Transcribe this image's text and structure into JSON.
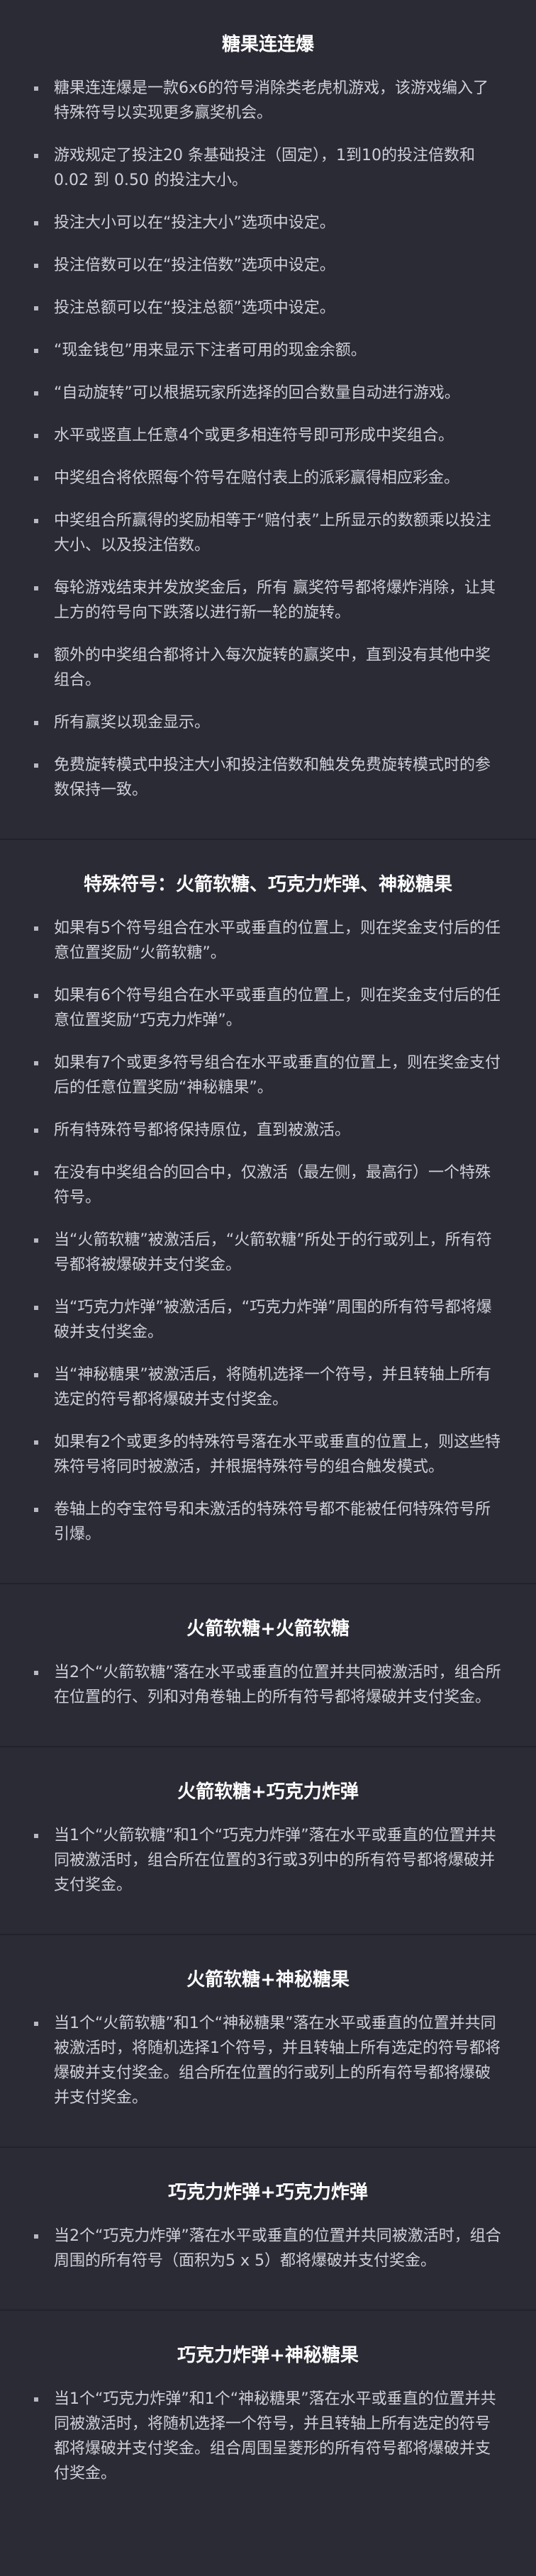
{
  "sections": [
    {
      "title": "糖果连连爆",
      "items": [
        "糖果连连爆是一款6x6的符号消除类老虎机游戏，该游戏编入了特殊符号以实现更多赢奖机会。",
        "游戏规定了投注20 条基础投注（固定），1到10的投注倍数和 0.02 到 0.50 的投注大小。",
        "投注大小可以在“投注大小”选项中设定。",
        "投注倍数可以在“投注倍数”选项中设定。",
        "投注总额可以在“投注总额”选项中设定。",
        "“现金钱包”用来显示下注者可用的现金余额。",
        "“自动旋转”可以根据玩家所选择的回合数量自动进行游戏。",
        "水平或竖直上任意4个或更多相连符号即可形成中奖组合。",
        "中奖组合将依照每个符号在赔付表上的派彩赢得相应彩金。",
        "中奖组合所赢得的奖励相等于“赔付表”上所显示的数额乘以投注大小、以及投注倍数。",
        "每轮游戏结束并发放奖金后，所有 赢奖符号都将爆炸消除，让其上方的符号向下跌落以进行新一轮的旋转。",
        "额外的中奖组合都将计入每次旋转的赢奖中，直到没有其他中奖组合。",
        "所有赢奖以现金显示。",
        "免费旋转模式中投注大小和投注倍数和触发免费旋转模式时的参数保持一致。"
      ]
    },
    {
      "title": "特殊符号：火箭软糖、巧克力炸弹、神秘糖果",
      "items": [
        "如果有5个符号组合在水平或垂直的位置上，则在奖金支付后的任意位置奖励“火箭软糖”。",
        "如果有6个符号组合在水平或垂直的位置上，则在奖金支付后的任意位置奖励“巧克力炸弹”。",
        "如果有7个或更多符号组合在水平或垂直的位置上，则在奖金支付后的任意位置奖励“神秘糖果”。",
        "所有特殊符号都将保持原位，直到被激活。",
        "在没有中奖组合的回合中，仅激活（最左侧，最高行）一个特殊符号。",
        "当“火箭软糖”被激活后，“火箭软糖”所处于的行或列上，所有符号都将被爆破并支付奖金。",
        "当“巧克力炸弹”被激活后，“巧克力炸弹”周围的所有符号都将爆破并支付奖金。",
        "当“神秘糖果”被激活后，将随机选择一个符号，并且转轴上所有选定的符号都将爆破并支付奖金。",
        "如果有2个或更多的特殊符号落在水平或垂直的位置上，则这些特殊符号将同时被激活，并根据特殊符号的组合触发模式。",
        "卷轴上的夺宝符号和未激活的特殊符号都不能被任何特殊符号所引爆。"
      ]
    },
    {
      "title": "火箭软糖+火箭软糖",
      "items": [
        "当2个“火箭软糖”落在水平或垂直的位置并共同被激活时，组合所在位置的行、列和对角卷轴上的所有符号都将爆破并支付奖金。"
      ]
    },
    {
      "title": "火箭软糖+巧克力炸弹",
      "items": [
        "当1个“火箭软糖”和1个“巧克力炸弹”落在水平或垂直的位置并共同被激活时，组合所在位置的3行或3列中的所有符号都将爆破并支付奖金。"
      ]
    },
    {
      "title": "火箭软糖+神秘糖果",
      "items": [
        "当1个“火箭软糖”和1个“神秘糖果”落在水平或垂直的位置并共同被激活时，将随机选择1个符号，并且转轴上所有选定的符号都将爆破并支付奖金。组合所在位置的行或列上的所有符号都将爆破并支付奖金。"
      ]
    },
    {
      "title": "巧克力炸弹+巧克力炸弹",
      "items": [
        "当2个“巧克力炸弹”落在水平或垂直的位置并共同被激活时，组合周围的所有符号（面积为5 x 5）都将爆破并支付奖金。"
      ]
    },
    {
      "title": "巧克力炸弹+神秘糖果",
      "items": [
        "当1个“巧克力炸弹”和1个“神秘糖果”落在水平或垂直的位置并共同被激活时，将随机选择一个符号，并且转轴上所有选定的符号都将爆破并支付奖金。组合周围呈菱形的所有符号都将爆破并支付奖金。"
      ]
    }
  ]
}
